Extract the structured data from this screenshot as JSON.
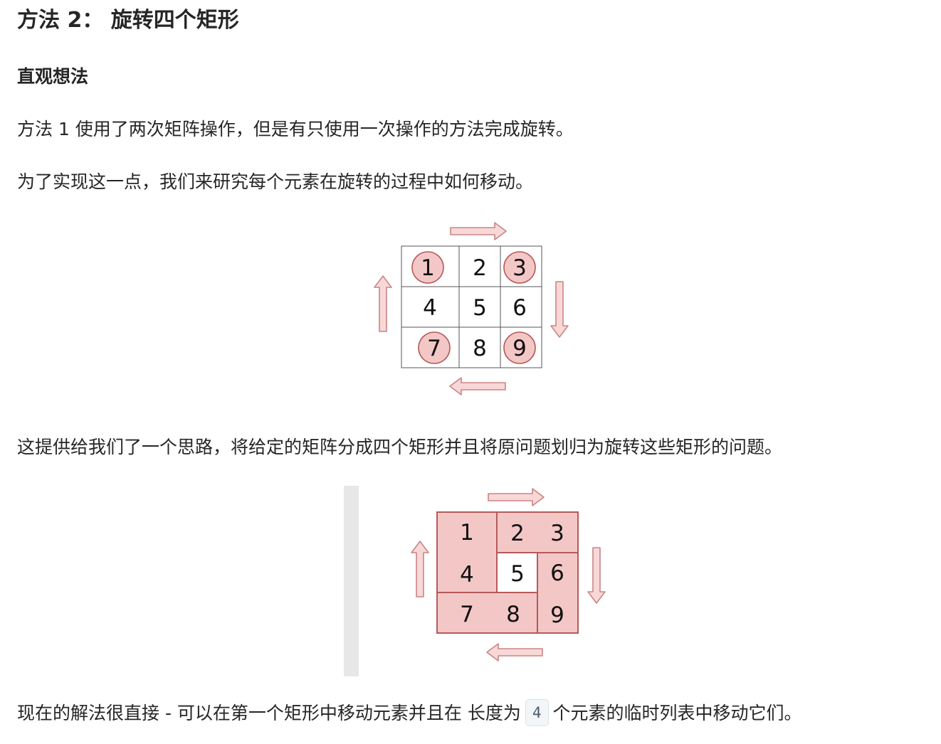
{
  "heading": "方法 2： 旋转四个矩形",
  "subheading": "直观想法",
  "paragraphs": {
    "p1": "方法 1 使用了两次矩阵操作，但是有只使用一次操作的方法完成旋转。",
    "p2": "为了实现这一点，我们来研究每个元素在旋转的过程中如何移动。",
    "p3": "这提供给我们了一个思路，将给定的矩阵分成四个矩形并且将原问题划归为旋转这些矩形的问题。",
    "p4_before": "现在的解法很直接 - 可以在第一个矩形中移动元素并且在 长度为",
    "p4_code": "4",
    "p4_after": "个元素的临时列表中移动它们。"
  },
  "figure1": {
    "cells": [
      "1",
      "2",
      "3",
      "4",
      "5",
      "6",
      "7",
      "8",
      "9"
    ],
    "circled": [
      "1",
      "3",
      "7",
      "9"
    ],
    "arrows": [
      "arrow-right-icon",
      "arrow-down-icon",
      "arrow-left-icon",
      "arrow-up-icon"
    ]
  },
  "figure2": {
    "cells": [
      "1",
      "2",
      "3",
      "4",
      "5",
      "6",
      "7",
      "8",
      "9"
    ],
    "highlighted": [
      "1",
      "2",
      "3",
      "4",
      "6",
      "7",
      "8",
      "9"
    ],
    "arrows": [
      "arrow-right-icon",
      "arrow-down-icon",
      "arrow-left-icon",
      "arrow-up-icon"
    ]
  },
  "colors": {
    "text": "#262626",
    "arrow_fill": "#f8d7d7",
    "arrow_stroke": "#c98585",
    "highlight_fill": "#f4c7c7",
    "highlight_stroke": "#b55a5a",
    "grid_stroke": "#333333"
  }
}
